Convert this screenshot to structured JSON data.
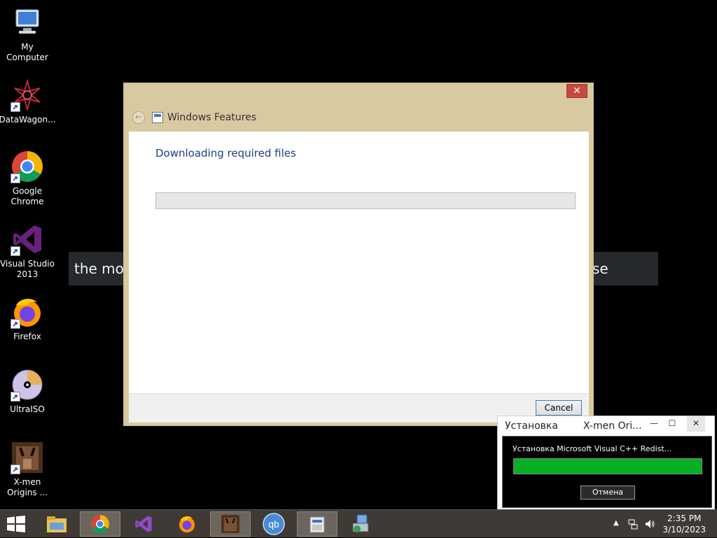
{
  "desktop": {
    "icons": [
      {
        "label": "My Computer",
        "icon": "computer-icon"
      },
      {
        "label": "DataWagon...",
        "icon": "datawagon-icon"
      },
      {
        "label": "Google\nChrome",
        "icon": "chrome-icon"
      },
      {
        "label": "Visual Studio\n2013",
        "icon": "visual-studio-icon"
      },
      {
        "label": "Firefox",
        "icon": "firefox-icon"
      },
      {
        "label": "UltraISO",
        "icon": "ultraiso-icon"
      },
      {
        "label": "X-men\nOrigins ...",
        "icon": "xmen-icon"
      }
    ]
  },
  "banner": {
    "left_text": "the mou",
    "right_text": "se"
  },
  "dialog": {
    "title": "Windows Features",
    "close_glyph": "✕",
    "back_glyph": "←",
    "status": "Downloading required files",
    "progress": 0,
    "cancel_label": "Cancel"
  },
  "installer": {
    "title_left": "Установка",
    "title_right": "X-men Ori...",
    "minimize_glyph": "—",
    "maximize_glyph": "☐",
    "close_glyph": "✕",
    "message": "Установка Microsoft Visual C++ Redist...",
    "progress": 1.0,
    "cancel_label": "Отмена"
  },
  "taskbar": {
    "apps": [
      "file-explorer",
      "chrome",
      "visual-studio",
      "firefox",
      "xmen",
      "qbittorrent",
      "windows-features",
      "installer"
    ],
    "qb_label": "qb",
    "tray_arrow": "▲",
    "time": "2:35 PM",
    "date": "3/10/2023"
  },
  "colors": {
    "dialog_frame": "#d9c9a0",
    "status_text": "#1e3f86",
    "progress_green": "#06b025",
    "taskbar": "#3f3a35"
  }
}
